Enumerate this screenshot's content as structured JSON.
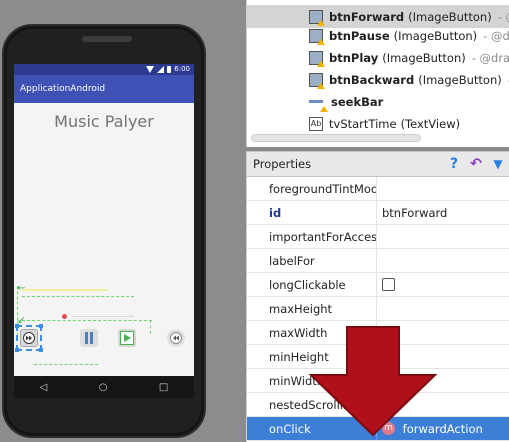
{
  "device": {
    "clock": "6:00",
    "app_title": "ApplicationAndroid",
    "screen_title": "Music Palyer",
    "nav_back": "◁",
    "nav_home": "○",
    "nav_recent": "□"
  },
  "component_tree": {
    "items": [
      {
        "name": "btnForward",
        "type": "(ImageButton)",
        "path": "- @d",
        "icon": "imagebutton-icon",
        "selected": true
      },
      {
        "name": "btnPause",
        "type": "(ImageButton)",
        "path": "- @drav",
        "icon": "imagebutton-icon",
        "selected": false
      },
      {
        "name": "btnPlay",
        "type": "(ImageButton)",
        "path": "- @drawa",
        "icon": "imagebutton-icon",
        "selected": false
      },
      {
        "name": "btnBackward",
        "type": "(ImageButton)",
        "path": "- @",
        "icon": "imagebutton-icon",
        "selected": false
      },
      {
        "name": "seekBar",
        "type": "",
        "path": "",
        "icon": "seekbar-icon",
        "selected": false
      },
      {
        "name": "tvStartTime",
        "type": "(TextView)",
        "path": "",
        "icon": "textview-icon",
        "selected": false
      }
    ]
  },
  "properties": {
    "title": "Properties",
    "help_glyph": "?",
    "undo_glyph": "↶",
    "filter_glyph": "▼",
    "rows": [
      {
        "name": "foregroundTintMod",
        "value": ""
      },
      {
        "name": "id",
        "value": "btnForward"
      },
      {
        "name": "importantForAccess",
        "value": ""
      },
      {
        "name": "labelFor",
        "value": ""
      },
      {
        "name": "longClickable",
        "value": ""
      },
      {
        "name": "maxHeight",
        "value": ""
      },
      {
        "name": "maxWidth",
        "value": ""
      },
      {
        "name": "minHeight",
        "value": ""
      },
      {
        "name": "minWidth",
        "value": ""
      },
      {
        "name": "nestedScrollingE",
        "value": ""
      },
      {
        "name": "onClick",
        "value": "forwardAction",
        "badge": "m"
      }
    ]
  },
  "colors": {
    "accent_blue": "#3f51b5",
    "status_blue": "#2c3a8f",
    "selection_blue": "#3d7fd6",
    "arrow_red": "#b0101a"
  }
}
